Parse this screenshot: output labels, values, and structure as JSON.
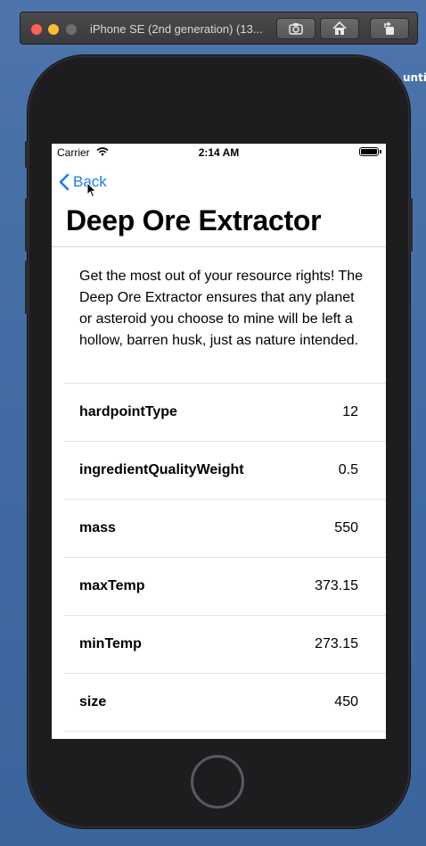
{
  "desktop": {
    "label": "unti"
  },
  "simulator": {
    "title": "iPhone SE (2nd generation) (13..."
  },
  "status_bar": {
    "carrier": "Carrier",
    "time": "2:14 AM"
  },
  "nav": {
    "back_label": "Back"
  },
  "item": {
    "title": "Deep Ore Extractor",
    "description": "Get the most out of your resource rights! The Deep Ore Extractor ensures that any planet or asteroid you choose to mine will be left a hollow, barren husk, just as nature intended."
  },
  "properties": [
    {
      "key": "hardpointType",
      "value": "12"
    },
    {
      "key": "ingredientQualityWeight",
      "value": "0.5"
    },
    {
      "key": "mass",
      "value": "550"
    },
    {
      "key": "maxTemp",
      "value": "373.15"
    },
    {
      "key": "minTemp",
      "value": "273.15"
    },
    {
      "key": "size",
      "value": "450"
    }
  ],
  "colors": {
    "accent": "#1a7cf2",
    "desktop": "#4a6fa5"
  }
}
